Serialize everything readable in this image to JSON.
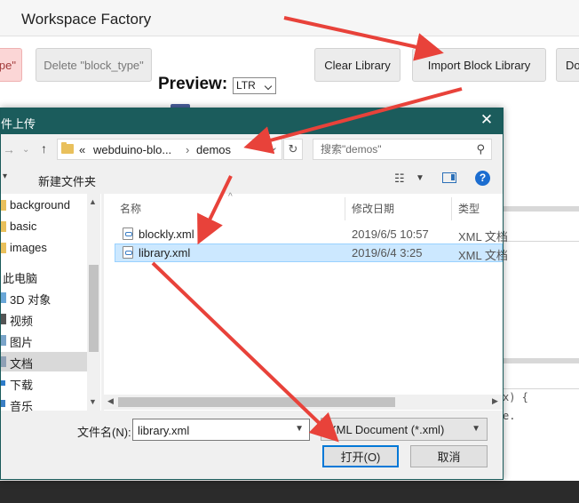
{
  "app": {
    "title": "Workspace Factory",
    "buttons": {
      "partial_left": "pe\"",
      "delete_block": "Delete \"block_type\"",
      "clear_library": "Clear Library",
      "import_library": "Import Block Library",
      "partial_right": "Do"
    },
    "preview_label": "Preview:",
    "direction_select": "LTR",
    "code_brace": "x) {",
    "code_dot": "e."
  },
  "dialog": {
    "title": "件上传",
    "close": "✕",
    "address": {
      "prefix": "«",
      "crumbs": [
        "webduino-blo...",
        "demos"
      ],
      "separator": "›"
    },
    "search_placeholder": "搜索\"demos\"",
    "new_folder": "新建文件夹",
    "nav_items": [
      {
        "label": "background",
        "icon": "folder-icon"
      },
      {
        "label": "basic",
        "icon": "folder-icon"
      },
      {
        "label": "images",
        "icon": "folder-icon"
      },
      {
        "label": "此电脑",
        "icon": "computer-icon"
      },
      {
        "label": "3D 对象",
        "icon": "cube-icon"
      },
      {
        "label": "视频",
        "icon": "video-icon"
      },
      {
        "label": "图片",
        "icon": "picture-icon"
      },
      {
        "label": "文档",
        "icon": "document-icon",
        "selected": true
      },
      {
        "label": "下载",
        "icon": "download-icon"
      },
      {
        "label": "音乐",
        "icon": "music-icon"
      }
    ],
    "columns": [
      "名称",
      "修改日期",
      "类型"
    ],
    "files": [
      {
        "name": "blockly.xml",
        "date": "2019/6/5 10:57",
        "type": "XML 文档"
      },
      {
        "name": "library.xml",
        "date": "2019/6/4 3:25",
        "type": "XML 文档",
        "selected": true
      }
    ],
    "filename_label": "文件名(N):",
    "filename_value": "library.xml",
    "filetype_value": "XML Document (*.xml)",
    "open_button": "打开(O)",
    "cancel_button": "取消"
  },
  "colors": {
    "annotation_arrow": "#e8423a",
    "dialog_titlebar": "#1b5c5c",
    "selection": "#cce8ff"
  }
}
